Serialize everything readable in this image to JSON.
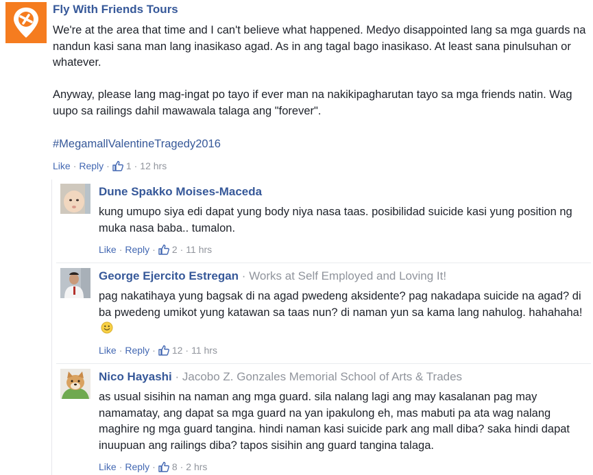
{
  "post": {
    "author": "Fly With Friends Tours",
    "paragraph1": "We're at the area that time and I can't believe what happened. Medyo disappointed lang sa mga guards na nandun kasi sana man lang inasikaso agad. As in ang tagal bago inasikaso. At least sana pinulsuhan or whatever.",
    "paragraph2": "Anyway, please lang mag-ingat po tayo if ever man na nakikipagharutan tayo sa mga friends natin. Wag uupo sa railings dahil mawawala talaga ang \"forever\".",
    "hashtag": "#MegamallValentineTragedy2016",
    "like_label": "Like",
    "reply_label": "Reply",
    "likes": "1",
    "time": "12 hrs"
  },
  "replies": [
    {
      "author": "Dune Spakko Moises-Maceda",
      "text": "kung umupo siya edi dapat yung body niya nasa taas. posibilidad suicide kasi yung position ng muka nasa baba.. tumalon.",
      "like_label": "Like",
      "reply_label": "Reply",
      "likes": "2",
      "time": "11 hrs"
    },
    {
      "author": "George Ejercito Estregan",
      "work": "Works at Self Employed and Loving It!",
      "text": "pag nakatihaya yung bagsak di na agad pwedeng aksidente? pag nakadapa suicide na agad? di ba pwedeng umikot yung katawan sa taas nun? di naman yun sa kama lang nahulog. hahahaha!",
      "like_label": "Like",
      "reply_label": "Reply",
      "likes": "12",
      "time": "11 hrs"
    },
    {
      "author": "Nico Hayashi",
      "work": "Jacobo Z. Gonzales Memorial School of Arts & Trades",
      "text": "as usual sisihin na naman ang mga guard. sila nalang lagi ang may kasalanan pag may namamatay, ang dapat sa mga guard na yan ipakulong eh, mas mabuti pa ata wag nalang maghire ng mga guard tangina. hindi naman kasi suicide park ang mall diba? saka hindi dapat inuupuan ang railings diba? tapos sisihin ang guard tangina talaga.",
      "like_label": "Like",
      "reply_label": "Reply",
      "likes": "8",
      "time": "2 hrs"
    }
  ],
  "colors": {
    "link": "#365899",
    "action": "#4267b2",
    "meta": "#90949c",
    "text": "#1d2129",
    "brand_avatar": "#f57c1f"
  },
  "icons": {
    "post_avatar": "airplane-pin-logo-icon",
    "like": "thumbs-up-icon",
    "emoji": "smile-emoji-icon"
  }
}
